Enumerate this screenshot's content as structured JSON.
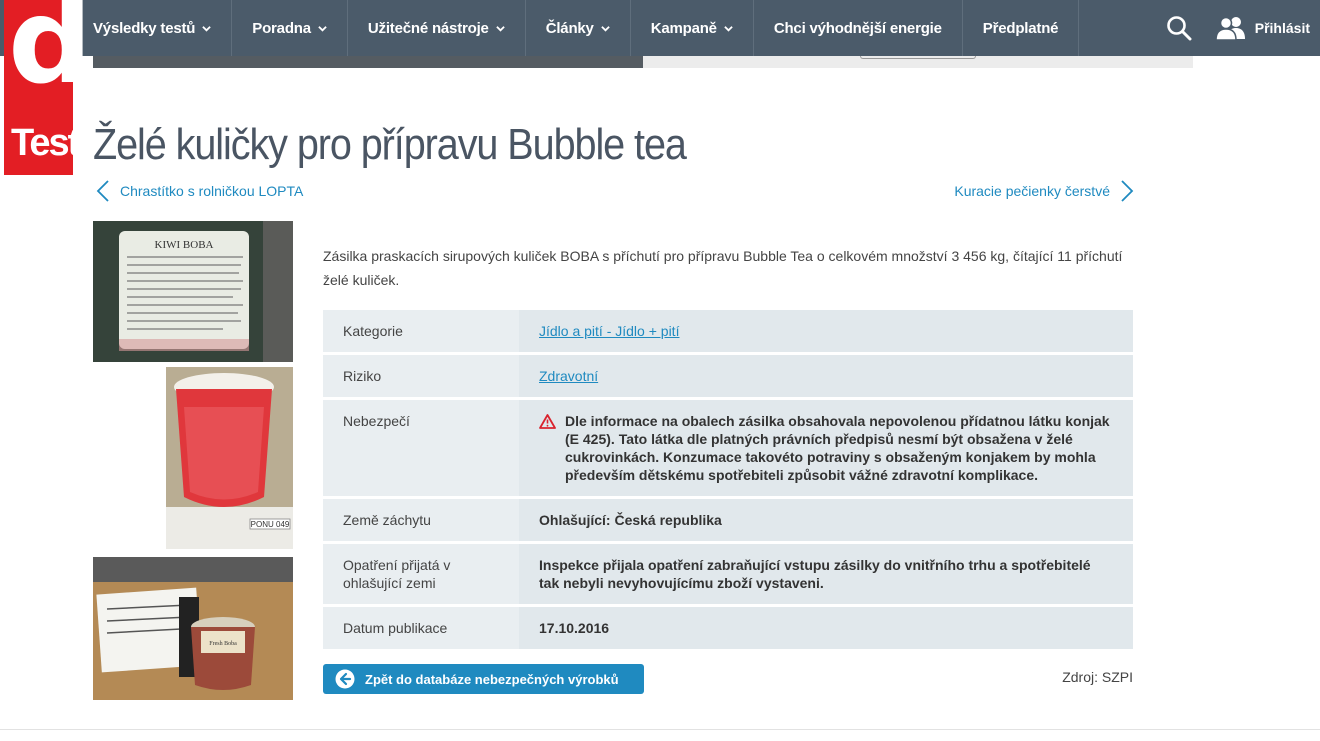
{
  "logo": {
    "letter": "d",
    "word": "Test"
  },
  "nav": {
    "items": [
      {
        "label": "Výsledky testů",
        "dropdown": true
      },
      {
        "label": "Poradna",
        "dropdown": true
      },
      {
        "label": "Užitečné nástroje",
        "dropdown": true
      },
      {
        "label": "Články",
        "dropdown": true
      },
      {
        "label": "Kampaně",
        "dropdown": true
      },
      {
        "label": "Chci výhodnější energie",
        "dropdown": false
      },
      {
        "label": "Předplatné",
        "dropdown": false
      }
    ],
    "login_label": "Přihlásit",
    "search_icon": "search-icon",
    "user_icon": "users-icon"
  },
  "page": {
    "title": "Želé kuličky pro přípravu Bubble tea",
    "prev_link": "Chrastítko s rolničkou LOPTA",
    "next_link": "Kuracie pečienky čerstvé",
    "description": "Zásilka praskacích sirupových kuliček BOBA s příchutí pro přípravu Bubble Tea o celkovém množství 3 456 kg, čítající 11 příchutí želé kuliček."
  },
  "thumbnails": {
    "label_text": "KIWI BOBA",
    "label_small": "INGREDIENTS: WATER, FRUCTOSE, CALCIUM LACTATE, MODIFIED STARCH, KIWI JUICE, MALIC ACID, SODIUM ALGINATE, XANTHAN GUM, CARRAGEENAN, KONJAC",
    "tag2": "PONU 049",
    "tag3": "Fresh Boba"
  },
  "table": {
    "rows": [
      {
        "label": "Kategorie",
        "value": "Jídlo a pití - Jídlo + pití",
        "type": "link"
      },
      {
        "label": "Riziko",
        "value": "Zdravotní",
        "type": "link"
      },
      {
        "label": "Nebezpečí",
        "value": "Dle informace na obalech zásilka obsahovala nepovolenou přídatnou látku konjak (E 425). Tato látka dle platných právních předpisů nesmí být obsažena v želé cukrovinkách. Konzumace takovéto potraviny s obsaženým konjakem by mohla především dětskému spotřebiteli způsobit vážné zdravotní komplikace.",
        "type": "danger"
      },
      {
        "label": "Země záchytu",
        "value": "Ohlašující: Česká republika",
        "type": "bold"
      },
      {
        "label": "Opatření přijatá v ohlašující zemi",
        "value": "Inspekce přijala opatření zabraňující vstupu zásilky do vnitřního trhu a spotřebitelé tak nebyli nevyhovujícímu zboží vystaveni.",
        "type": "bold"
      },
      {
        "label": "Datum publikace",
        "value": "17.10.2016",
        "type": "bold"
      }
    ]
  },
  "back_button": "Zpět do databáze nebezpečných výrobků",
  "source": "Zdroj: SZPI",
  "colors": {
    "nav": "#4b5b6a",
    "brand_red": "#e31e24",
    "link": "#1f8ac0",
    "danger": "#d9232e"
  }
}
